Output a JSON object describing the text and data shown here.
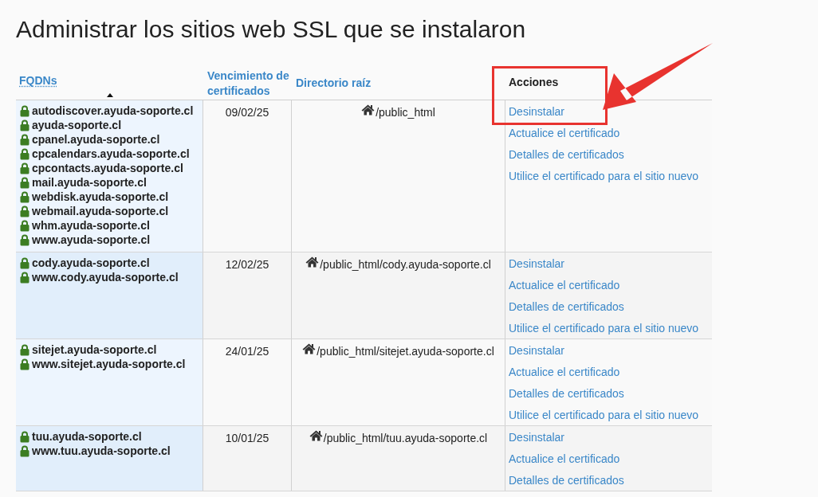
{
  "title": "Administrar los sitios web SSL que se instalaron",
  "table": {
    "columns": [
      {
        "label": "FQDNs",
        "kind": "sortable",
        "sorted": true
      },
      {
        "label": "Vencimiento de certificados",
        "kind": "link"
      },
      {
        "label": "Directorio raíz",
        "kind": "link"
      },
      {
        "label": "Acciones",
        "kind": "plain"
      }
    ],
    "rows": [
      {
        "fqdns": [
          "autodiscover.ayuda-soporte.cl",
          "ayuda-soporte.cl",
          "cpanel.ayuda-soporte.cl",
          "cpcalendars.ayuda-soporte.cl",
          "cpcontacts.ayuda-soporte.cl",
          "mail.ayuda-soporte.cl",
          "webdisk.ayuda-soporte.cl",
          "webmail.ayuda-soporte.cl",
          "whm.ayuda-soporte.cl",
          "www.ayuda-soporte.cl"
        ],
        "expiry": "09/02/25",
        "root": "/public_html",
        "actions": [
          "Desinstalar",
          "Actualice el certificado",
          "Detalles de certificados",
          "Utilice el certificado para el sitio nuevo"
        ]
      },
      {
        "fqdns": [
          "cody.ayuda-soporte.cl",
          "www.cody.ayuda-soporte.cl"
        ],
        "expiry": "12/02/25",
        "root": "/public_html/cody.ayuda-soporte.cl",
        "actions": [
          "Desinstalar",
          "Actualice el certificado",
          "Detalles de certificados",
          "Utilice el certificado para el sitio nuevo"
        ]
      },
      {
        "fqdns": [
          "sitejet.ayuda-soporte.cl",
          "www.sitejet.ayuda-soporte.cl"
        ],
        "expiry": "24/01/25",
        "root": "/public_html/sitejet.ayuda-soporte.cl",
        "actions": [
          "Desinstalar",
          "Actualice el certificado",
          "Detalles de certificados",
          "Utilice el certificado para el sitio nuevo"
        ]
      },
      {
        "fqdns": [
          "tuu.ayuda-soporte.cl",
          "www.tuu.ayuda-soporte.cl"
        ],
        "expiry": "10/01/25",
        "root": "/public_html/tuu.ayuda-soporte.cl",
        "actions": [
          "Desinstalar",
          "Actualice el certificado",
          "Detalles de certificados"
        ]
      }
    ]
  }
}
